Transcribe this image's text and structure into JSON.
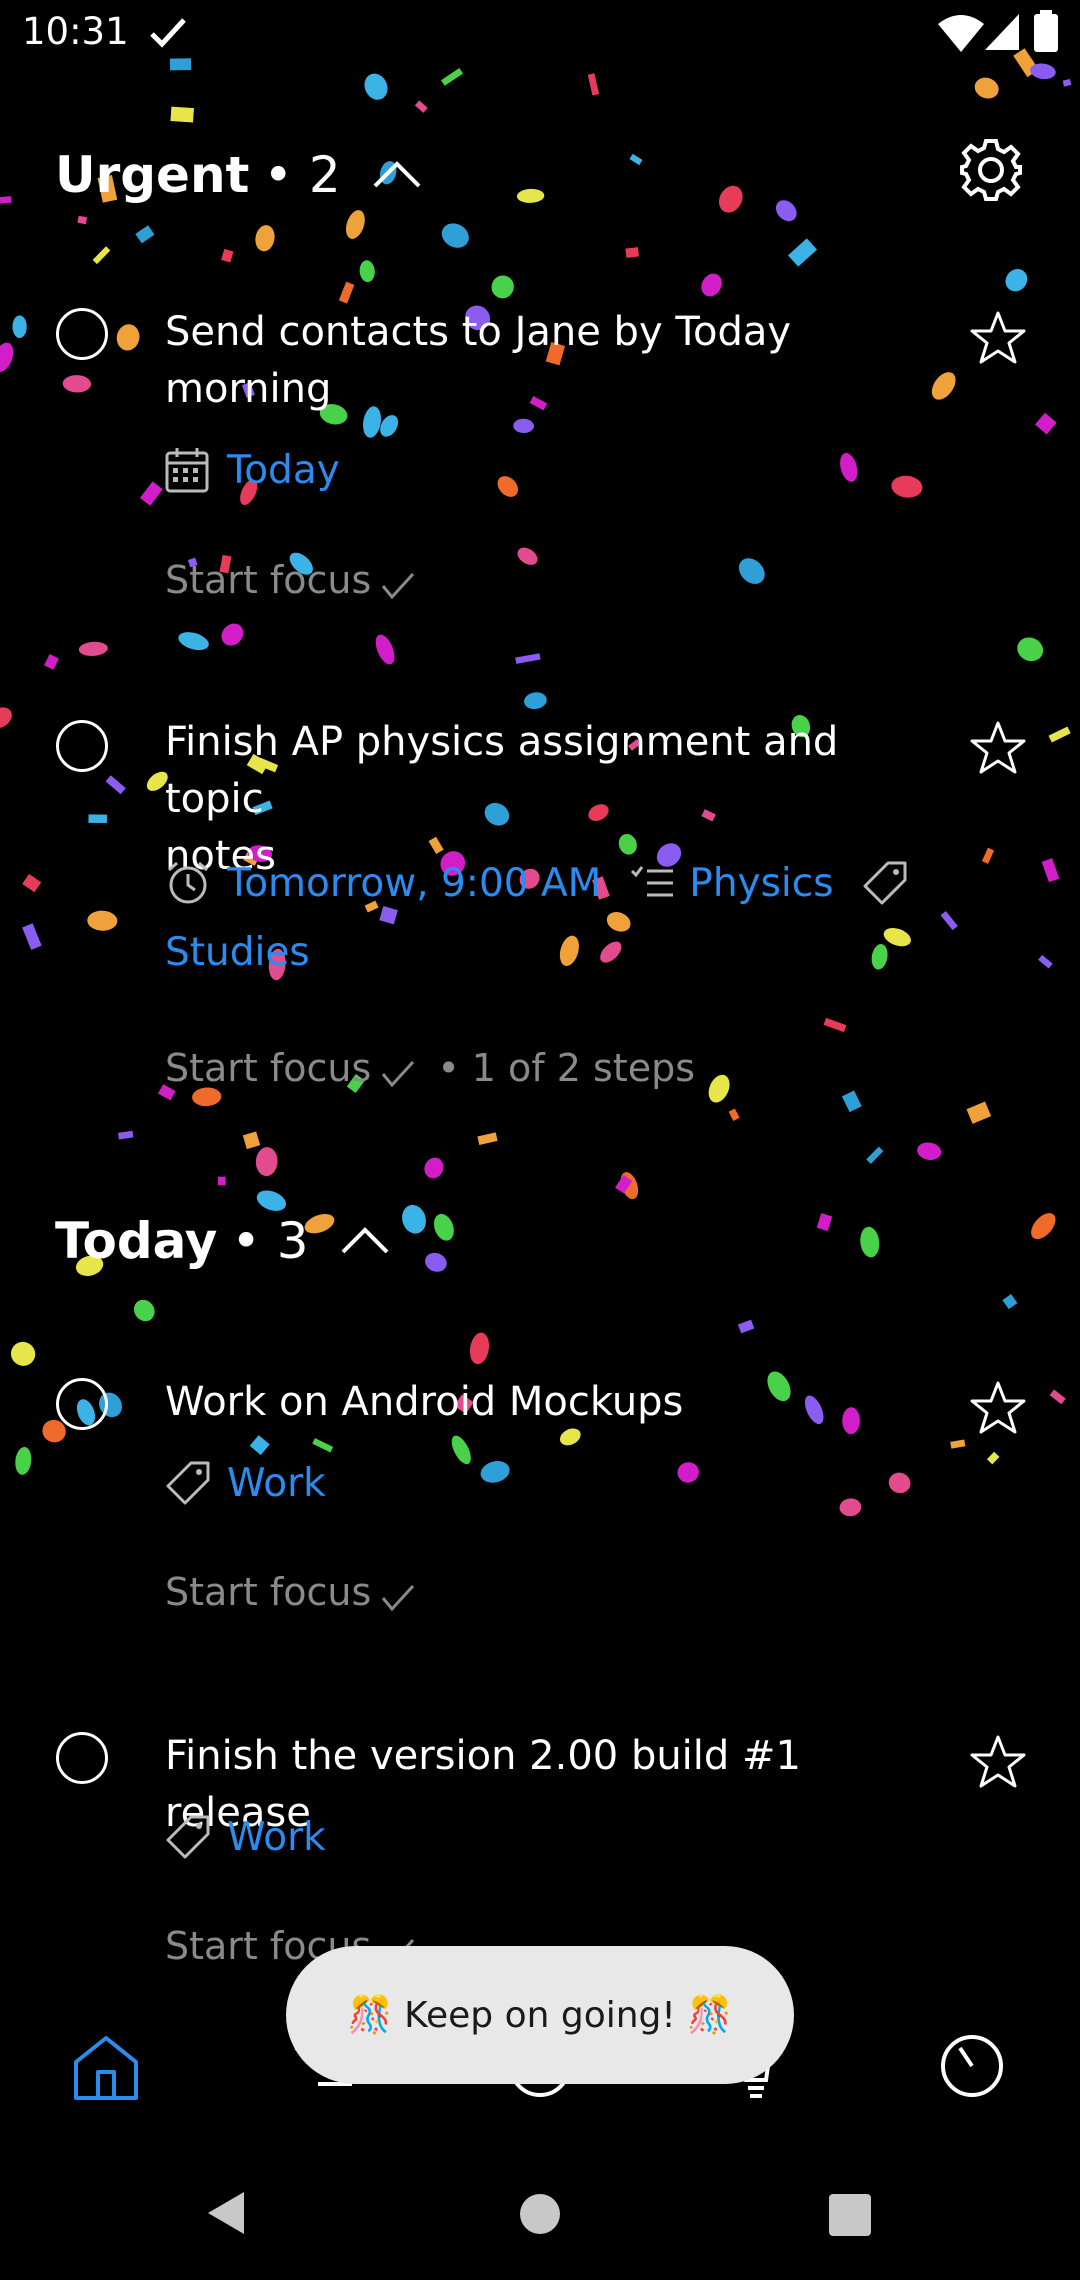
{
  "status_bar": {
    "time": "10:31"
  },
  "sections": [
    {
      "title": "Urgent",
      "count": "• 2",
      "tasks": [
        {
          "title_lines": [
            "Send contacts to Jane by Today",
            "morning"
          ],
          "meta": {
            "date": "Today"
          },
          "focus": "Start focus"
        },
        {
          "title_lines": [
            "Finish AP physics assignment and topic",
            "notes"
          ],
          "meta": {
            "reminder": "Tomorrow, 9:00 AM",
            "list": "Physics",
            "tag": "Studies"
          },
          "focus": "Start focus",
          "steps": "• 1 of 2 steps"
        }
      ]
    },
    {
      "title": "Today",
      "count": "• 3",
      "tasks": [
        {
          "title_lines": [
            "Work on Android Mockups"
          ],
          "meta": {
            "tag": "Work"
          },
          "focus": "Start focus"
        },
        {
          "title_lines": [
            "Finish the version 2.00 build #1 release"
          ],
          "meta": {
            "tag": "Work"
          },
          "focus": "Start focus"
        }
      ]
    }
  ],
  "toast": {
    "text": "🎊 Keep on going! 🎊"
  },
  "bottom_nav": [
    "home-icon",
    "lists-icon",
    "add-icon",
    "ideas-icon",
    "focus-timer-icon"
  ],
  "colors": {
    "accent": "#2b8cf0",
    "muted": "#8a8a8a",
    "background": "#000000"
  }
}
